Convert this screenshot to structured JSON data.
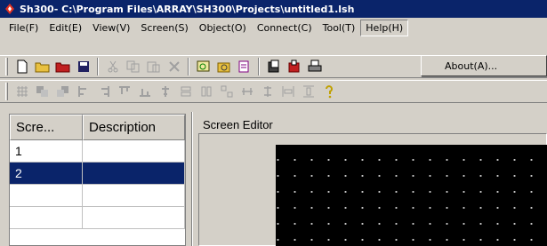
{
  "window": {
    "title": "Sh300- C:\\Program Files\\ARRAY\\SH300\\Projects\\untitled1.lsh"
  },
  "menu": {
    "items": [
      {
        "id": "file",
        "label": "File(F)"
      },
      {
        "id": "edit",
        "label": "Edit(E)"
      },
      {
        "id": "view",
        "label": "View(V)"
      },
      {
        "id": "screen",
        "label": "Screen(S)"
      },
      {
        "id": "object",
        "label": "Object(O)"
      },
      {
        "id": "connect",
        "label": "Connect(C)"
      },
      {
        "id": "tool",
        "label": "Tool(T)"
      },
      {
        "id": "help",
        "label": "Help(H)"
      }
    ],
    "help_dropdown": {
      "about_label": "About(A)..."
    }
  },
  "colors": {
    "title_bar": "#0a246a",
    "selection": "#0a246a",
    "canvas": "#000000",
    "chrome": "#d4d0c8"
  },
  "screen_list": {
    "columns": [
      "Scre...",
      "Description"
    ],
    "rows": [
      {
        "screen": "1",
        "description": ""
      },
      {
        "screen": "2",
        "description": "",
        "selected": true
      },
      {
        "screen": "",
        "description": ""
      },
      {
        "screen": "",
        "description": ""
      }
    ]
  },
  "editor": {
    "label": "Screen Editor"
  }
}
